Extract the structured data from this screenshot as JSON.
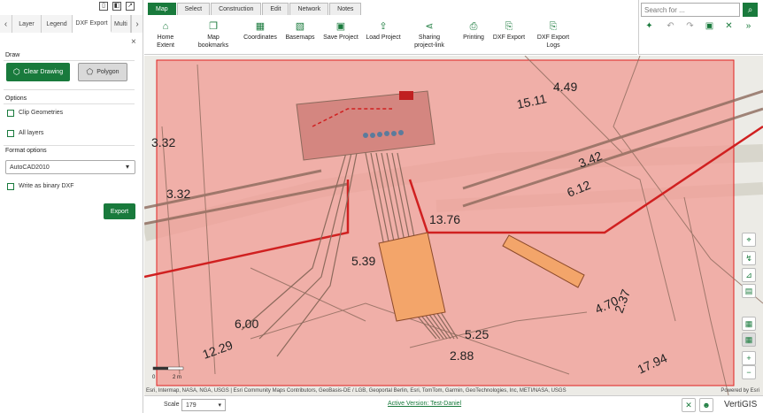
{
  "panel": {
    "tabs": [
      "Layer",
      "Legend",
      "DXF Export",
      "Multi"
    ],
    "draw_header": "Draw",
    "clear_drawing": "Clear Drawing",
    "polygon": "Polygon",
    "options_header": "Options",
    "clip_geometries": "Clip Geometries",
    "all_layers": "All layers",
    "format_header": "Format options",
    "format_value": "AutoCAD2010",
    "binary_dxf": "Write as binary DXF",
    "export": "Export"
  },
  "ribbon": {
    "tabs": [
      "Map",
      "Select",
      "Construction",
      "Edit",
      "Network",
      "Notes"
    ],
    "buttons": [
      "Home Extent",
      "Map bookmarks",
      "Coordinates",
      "Basemaps",
      "Save Project",
      "Load Project",
      "Sharing project-link",
      "Printing",
      "DXF Export",
      "DXF Export Logs"
    ]
  },
  "search": {
    "placeholder": "Search for ..."
  },
  "map": {
    "labels": [
      "3.32",
      "3.32",
      "15.11",
      "4.49",
      "3.42",
      "6.12",
      "13.76",
      "5.39",
      "6.00",
      "12.29",
      "5.25",
      "2.88",
      "4.70",
      "2.37",
      "17.94"
    ],
    "scalebar": {
      "zero": "0",
      "two": "2 m"
    },
    "attribution": "Esri, Intermap, NASA, NGA, USGS | Esri Community Maps Contributors, GeoBasis-DE / LGB, Geoportal Berlin, Esri, TomTom, Garmin, GeoTechnologies, Inc, METI/NASA, USGS",
    "powered": "Powered by Esri"
  },
  "bottom": {
    "scale_label": "Scale",
    "scale_value": "179",
    "active_version": "Active Version: Test-Daniel",
    "logo": "VertiGIS"
  }
}
